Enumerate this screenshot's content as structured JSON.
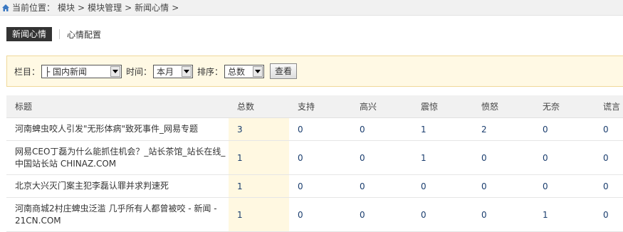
{
  "breadcrumb": {
    "label": "当前位置：",
    "items": [
      "模块",
      ">",
      "模块管理",
      ">",
      "新闻心情",
      ">"
    ]
  },
  "tabs": [
    {
      "label": "新闻心情",
      "active": true
    },
    {
      "label": "心情配置",
      "active": false
    }
  ],
  "filter": {
    "column_label": "栏目：",
    "column_value": "├ 国内新闻",
    "time_label": "时间：",
    "time_value": "本月",
    "sort_label": "排序：",
    "sort_value": "总数",
    "submit_label": "查看"
  },
  "table": {
    "headers": [
      "标题",
      "总数",
      "支持",
      "高兴",
      "震惊",
      "愤怒",
      "无奈",
      "谎言"
    ],
    "rows": [
      {
        "title": "河南蜱虫咬人引发\"无形体病\"致死事件_网易专题",
        "values": [
          "3",
          "0",
          "0",
          "1",
          "2",
          "0",
          "0"
        ]
      },
      {
        "title": "网易CEO丁磊为什么能抓住机会？_站长茶馆_站长在线_中国站长站 CHINAZ.COM",
        "values": [
          "1",
          "0",
          "0",
          "1",
          "0",
          "0",
          "0"
        ]
      },
      {
        "title": "北京大兴灭门案主犯李磊认罪并求判速死",
        "values": [
          "1",
          "0",
          "0",
          "0",
          "0",
          "0",
          "0"
        ]
      },
      {
        "title": "河南商城2村庄蜱虫泛滥 几乎所有人都曾被咬 - 新闻 - 21CN.COM",
        "values": [
          "1",
          "0",
          "0",
          "0",
          "0",
          "1",
          "0"
        ]
      }
    ]
  },
  "colors": {
    "filter_bg": "#fff9e4",
    "total_col_bg": "#fff8e1",
    "active_tab_bg": "#333333"
  }
}
